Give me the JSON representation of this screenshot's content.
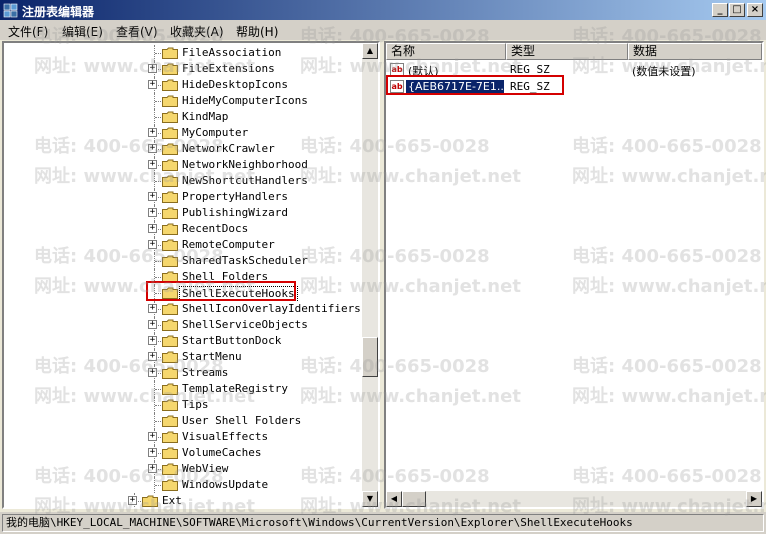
{
  "window": {
    "title": "注册表编辑器"
  },
  "caption_buttons": {
    "minimize": "_",
    "maximize": "□",
    "close": "×"
  },
  "menu": [
    "文件(F)",
    "编辑(E)",
    "查看(V)",
    "收藏夹(A)",
    "帮助(H)"
  ],
  "tree": {
    "items": [
      {
        "label": "FileAssociation",
        "expandable": false
      },
      {
        "label": "FileExtensions",
        "expandable": true
      },
      {
        "label": "HideDesktopIcons",
        "expandable": true
      },
      {
        "label": "HideMyComputerIcons",
        "expandable": false
      },
      {
        "label": "KindMap",
        "expandable": false
      },
      {
        "label": "MyComputer",
        "expandable": true
      },
      {
        "label": "NetworkCrawler",
        "expandable": true
      },
      {
        "label": "NetworkNeighborhood",
        "expandable": true
      },
      {
        "label": "NewShortcutHandlers",
        "expandable": false
      },
      {
        "label": "PropertyHandlers",
        "expandable": true
      },
      {
        "label": "PublishingWizard",
        "expandable": true
      },
      {
        "label": "RecentDocs",
        "expandable": true
      },
      {
        "label": "RemoteComputer",
        "expandable": true
      },
      {
        "label": "SharedTaskScheduler",
        "expandable": false
      },
      {
        "label": "Shell Folders",
        "expandable": false
      },
      {
        "label": "ShellExecuteHooks",
        "expandable": false,
        "selected": true
      },
      {
        "label": "ShellIconOverlayIdentifiers",
        "expandable": true
      },
      {
        "label": "ShellServiceObjects",
        "expandable": true
      },
      {
        "label": "StartButtonDock",
        "expandable": true
      },
      {
        "label": "StartMenu",
        "expandable": true
      },
      {
        "label": "Streams",
        "expandable": true
      },
      {
        "label": "TemplateRegistry",
        "expandable": false
      },
      {
        "label": "Tips",
        "expandable": false
      },
      {
        "label": "User Shell Folders",
        "expandable": false
      },
      {
        "label": "VisualEffects",
        "expandable": true
      },
      {
        "label": "VolumeCaches",
        "expandable": true
      },
      {
        "label": "WebView",
        "expandable": true
      },
      {
        "label": "WindowsUpdate",
        "expandable": false
      },
      {
        "label": "Ext",
        "expandable": true,
        "indent": "parent"
      }
    ]
  },
  "list": {
    "columns": [
      "名称",
      "类型",
      "数据"
    ],
    "rows": [
      {
        "name": "(默认)",
        "type": "REG_SZ",
        "data": "(数值未设置)"
      },
      {
        "name": "{AEB6717E-7E1...",
        "type": "REG_SZ",
        "data": "",
        "selected": true
      }
    ]
  },
  "status": {
    "path": "我的电脑\\HKEY_LOCAL_MACHINE\\SOFTWARE\\Microsoft\\Windows\\CurrentVersion\\Explorer\\ShellExecuteHooks"
  },
  "watermark": {
    "phone": "电话: 400-665-0028",
    "site": "网址: www.chanjet.net"
  },
  "colors": {
    "highlight": "#d40000",
    "selection": "#0a246a",
    "title_start": "#0a246a"
  }
}
